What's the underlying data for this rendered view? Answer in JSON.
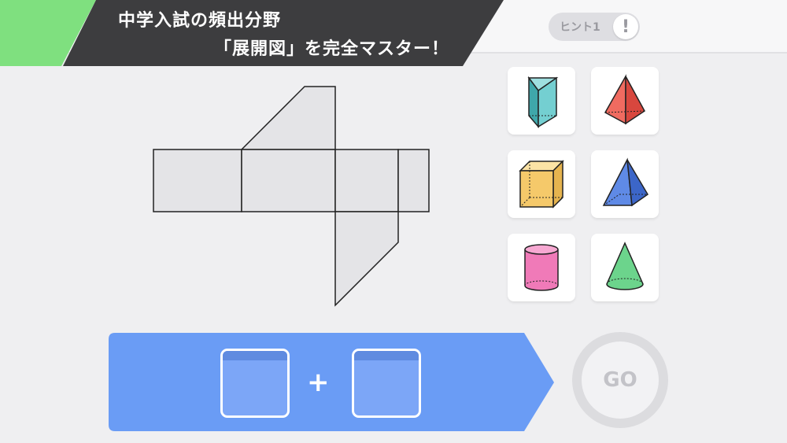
{
  "header": {
    "title_line1": "中学入試の頻出分野",
    "title_line2": "「展開図」を完全マスター！",
    "accent_color": "#7fe07f",
    "banner_color": "#3d3d3f"
  },
  "hint": {
    "label": "ヒント1",
    "icon_glyph": "!",
    "icon": "exclamation-icon"
  },
  "shape_choices": [
    {
      "name": "triangular-prism",
      "color": "#5ec6c8"
    },
    {
      "name": "triangular-pyramid",
      "color": "#ee5a50"
    },
    {
      "name": "cube",
      "color": "#f5c96a"
    },
    {
      "name": "square-pyramid",
      "color": "#4c78dc"
    },
    {
      "name": "cylinder",
      "color": "#f07ab8"
    },
    {
      "name": "cone",
      "color": "#6cd48c"
    }
  ],
  "answer": {
    "operator": "+",
    "bar_color": "#6a9cf5"
  },
  "go_button": {
    "label": "GO"
  }
}
